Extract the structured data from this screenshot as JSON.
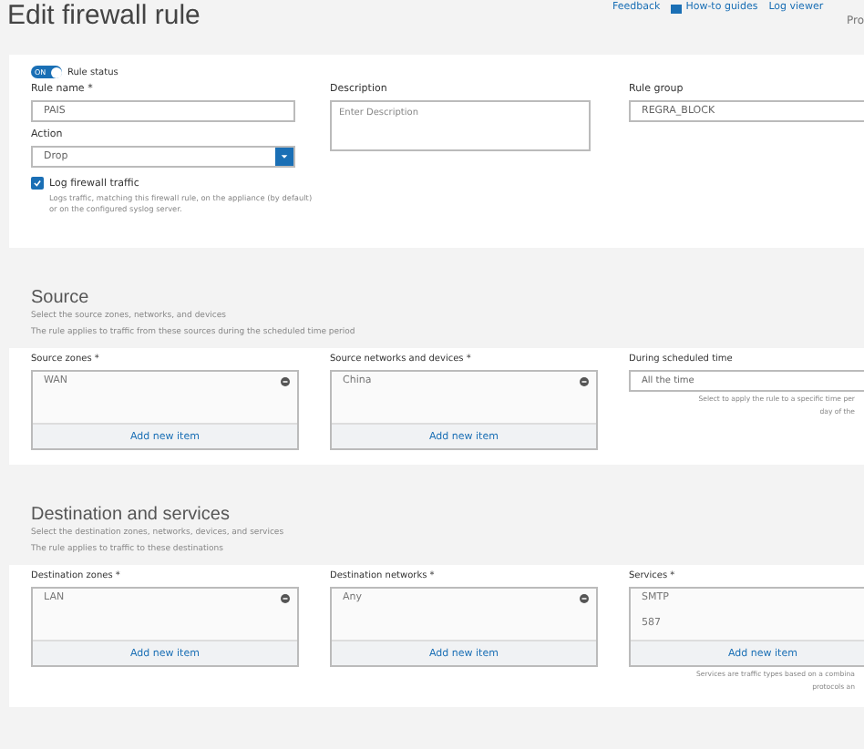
{
  "header": {
    "title": "Edit firewall rule",
    "links": [
      {
        "label": "Feedback",
        "kind": "text"
      },
      {
        "label": "How-to guides",
        "kind": "guide"
      },
      {
        "label": "Log viewer",
        "kind": "text"
      }
    ],
    "subtext": "Pro"
  },
  "rule": {
    "status": {
      "on": true,
      "switch_text": "ON",
      "caption": "Rule status"
    },
    "name": {
      "label": "Rule name *",
      "value": "PAIS"
    },
    "action": {
      "label": "Action",
      "value": "Drop"
    },
    "log": {
      "checked": true,
      "label": "Log firewall traffic",
      "help": "Logs traffic, matching this firewall rule, on the appliance (by default) or on the configured syslog server."
    },
    "description": {
      "label": "Description",
      "placeholder": "Enter Description"
    },
    "group": {
      "label": "Rule group",
      "value": "REGRA_BLOCK"
    }
  },
  "sections": [
    {
      "title": "Source",
      "lines": [
        "Select the source zones, networks, and devices",
        "The rule applies to traffic from these sources during the scheduled time period"
      ],
      "fields": [
        {
          "kind": "list",
          "label": "Source zones *",
          "items": [
            "WAN"
          ],
          "add": "Add new item"
        },
        {
          "kind": "list",
          "label": "Source networks and devices *",
          "items": [
            "China"
          ],
          "add": "Add new item"
        },
        {
          "kind": "select",
          "label": "During scheduled time",
          "value": "All the time",
          "help": [
            "Select to apply the rule to a specific time per",
            "day of the"
          ]
        }
      ]
    },
    {
      "title": "Destination and services",
      "lines": [
        "Select the destination zones, networks, devices, and services",
        "The rule applies to traffic to these destinations"
      ],
      "fields": [
        {
          "kind": "list",
          "label": "Destination zones *",
          "items": [
            "LAN"
          ],
          "add": "Add new item"
        },
        {
          "kind": "list",
          "label": "Destination networks *",
          "items": [
            "Any"
          ],
          "add": "Add new item"
        },
        {
          "kind": "list",
          "label": "Services *",
          "items": [
            "SMTP",
            "587"
          ],
          "add": "Add new item",
          "help": [
            "Services are traffic types based on a combina",
            "protocols an"
          ]
        }
      ]
    }
  ]
}
